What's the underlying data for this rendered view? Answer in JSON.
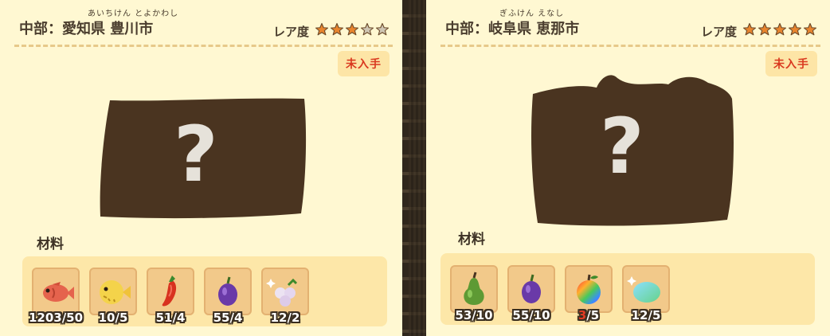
{
  "left": {
    "region_prefix": "中部：",
    "region_name": "愛知県 豊川市",
    "ruby": "あいちけん とよかわし",
    "rarity_label": "レア度",
    "rarity_stars": 3,
    "rarity_max": 5,
    "status_badge": "未入手",
    "mystery_mark": "?",
    "materials_title": "材料",
    "materials": [
      {
        "icon": "fish-icon",
        "count": "1203/50"
      },
      {
        "icon": "pufferfish-icon",
        "count": "10/5"
      },
      {
        "icon": "chili-pepper-icon",
        "count": "51/4"
      },
      {
        "icon": "plum-icon",
        "count": "55/4"
      },
      {
        "icon": "grapes-icon",
        "count": "12/2"
      }
    ]
  },
  "right": {
    "region_prefix": "中部：",
    "region_name": "岐阜県 恵那市",
    "ruby": "ぎふけん えなし",
    "rarity_label": "レア度",
    "rarity_stars": 5,
    "rarity_max": 5,
    "status_badge": "未入手",
    "mystery_mark": "?",
    "materials_title": "材料",
    "materials": [
      {
        "icon": "pear-icon",
        "count": "53/10"
      },
      {
        "icon": "plum-icon",
        "count": "55/10"
      },
      {
        "icon": "rainbow-apple-icon",
        "count_have": "3",
        "count_need": "/5"
      },
      {
        "icon": "lemon-icon",
        "count": "12/5"
      }
    ]
  },
  "colors": {
    "card_bg": "#fff8d2",
    "star_filled": "#e9852e",
    "star_empty": "#cfc6b3",
    "badge_text": "#d9391f",
    "silhouette": "#4a3420"
  }
}
